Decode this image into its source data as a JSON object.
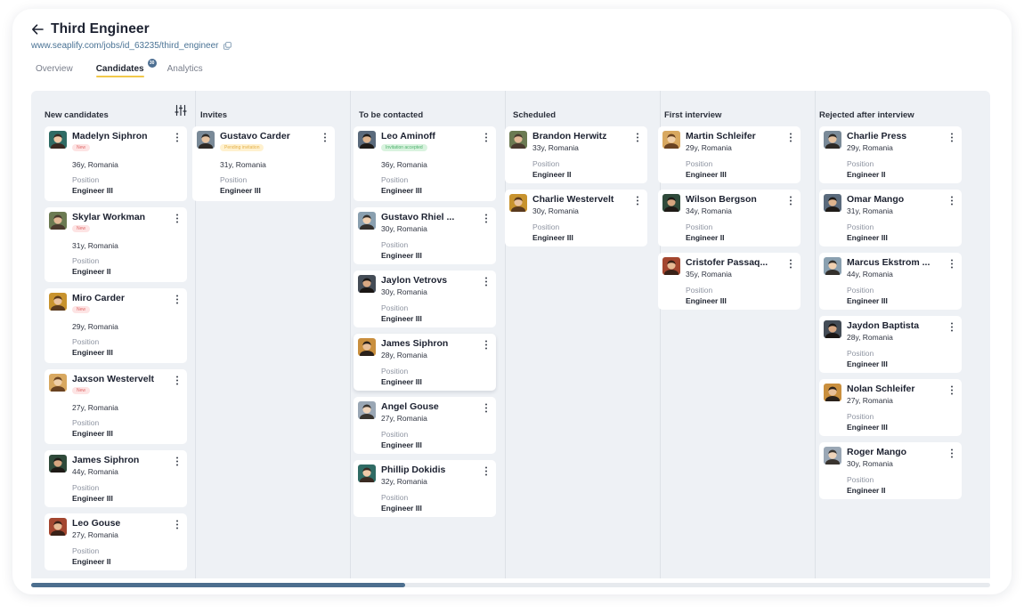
{
  "page": {
    "title": "Third Engineer",
    "url": "www.seaplify.com/jobs/id_63235/third_engineer"
  },
  "tabs": [
    {
      "label": "Overview",
      "active": false
    },
    {
      "label": "Candidates",
      "active": true,
      "badge": "30"
    },
    {
      "label": "Analytics",
      "active": false
    }
  ],
  "colors": {
    "accent_underline": "#f1c84a",
    "badge_bg": "#4d6f92",
    "board_bg": "#eef1f5",
    "scroll_thumb": "#4c6e8e",
    "status_new": "#e06a6a",
    "status_pending": "#e3b04a",
    "status_accepted": "#4bb06a"
  },
  "columns": [
    {
      "title": "New candidates",
      "has_filter": true,
      "cards": [
        {
          "name": "Madelyn Siphron",
          "status": "New",
          "status_type": "new",
          "age_location": "36y, Romania",
          "position_label": "Position",
          "position": "Engineer III"
        },
        {
          "name": "Skylar Workman",
          "status": "New",
          "status_type": "new",
          "age_location": "31y, Romania",
          "position_label": "Position",
          "position": "Engineer II"
        },
        {
          "name": "Miro Carder",
          "status": "New",
          "status_type": "new",
          "age_location": "29y, Romania",
          "position_label": "Position",
          "position": "Engineer III"
        },
        {
          "name": "Jaxson Westervelt",
          "status": "New",
          "status_type": "new",
          "age_location": "27y, Romania",
          "position_label": "Position",
          "position": "Engineer III"
        },
        {
          "name": "James Siphron",
          "status": "",
          "status_type": "",
          "age_location": "44y, Romania",
          "position_label": "Position",
          "position": "Engineer III"
        },
        {
          "name": "Leo Gouse",
          "status": "",
          "status_type": "",
          "age_location": "27y, Romania",
          "position_label": "Position",
          "position": "Engineer II"
        }
      ]
    },
    {
      "title": "Invites",
      "has_filter": false,
      "cards": [
        {
          "name": "Gustavo Carder",
          "status": "Pending invitation",
          "status_type": "pending",
          "age_location": "31y, Romania",
          "position_label": "Position",
          "position": "Engineer III"
        }
      ]
    },
    {
      "title": "To be contacted",
      "has_filter": false,
      "cards": [
        {
          "name": "Leo Aminoff",
          "status": "Invitation accepted",
          "status_type": "accepted",
          "age_location": "36y, Romania",
          "position_label": "Position",
          "position": "Engineer III"
        },
        {
          "name": "Gustavo Rhiel ...",
          "status": "",
          "status_type": "",
          "age_location": "30y, Romania",
          "position_label": "Position",
          "position": "Engineer III"
        },
        {
          "name": "Jaylon Vetrovs",
          "status": "",
          "status_type": "",
          "age_location": "30y, Romania",
          "position_label": "Position",
          "position": "Engineer III"
        },
        {
          "name": "James Siphron",
          "status": "",
          "status_type": "",
          "age_location": "28y, Romania",
          "position_label": "Position",
          "position": "Engineer III",
          "raised": true
        },
        {
          "name": "Angel Gouse",
          "status": "",
          "status_type": "",
          "age_location": "27y, Romania",
          "position_label": "Position",
          "position": "Engineer III"
        },
        {
          "name": "Phillip Dokidis",
          "status": "",
          "status_type": "",
          "age_location": "32y, Romania",
          "position_label": "Position",
          "position": "Engineer III"
        }
      ]
    },
    {
      "title": "Scheduled",
      "has_filter": false,
      "cards": [
        {
          "name": "Brandon Herwitz",
          "status": "",
          "status_type": "",
          "age_location": "33y, Romania",
          "position_label": "Position",
          "position": "Engineer II"
        },
        {
          "name": "Charlie Westervelt",
          "status": "",
          "status_type": "",
          "age_location": "30y, Romania",
          "position_label": "Position",
          "position": "Engineer III"
        }
      ]
    },
    {
      "title": "First interview",
      "has_filter": false,
      "cards": [
        {
          "name": "Martin Schleifer",
          "status": "",
          "status_type": "",
          "age_location": "29y, Romania",
          "position_label": "Position",
          "position": "Engineer III"
        },
        {
          "name": "Wilson Bergson",
          "status": "",
          "status_type": "",
          "age_location": "34y, Romania",
          "position_label": "Position",
          "position": "Engineer II"
        },
        {
          "name": "Cristofer Passaq...",
          "status": "",
          "status_type": "",
          "age_location": "35y, Romania",
          "position_label": "Position",
          "position": "Engineer III"
        }
      ]
    },
    {
      "title": "Rejected after interview",
      "has_filter": false,
      "cards": [
        {
          "name": "Charlie Press",
          "status": "",
          "status_type": "",
          "age_location": "29y, Romania",
          "position_label": "Position",
          "position": "Engineer II"
        },
        {
          "name": "Omar Mango",
          "status": "",
          "status_type": "",
          "age_location": "31y, Romania",
          "position_label": "Position",
          "position": "Engineer III"
        },
        {
          "name": "Marcus Ekstrom ...",
          "status": "",
          "status_type": "",
          "age_location": "44y, Romania",
          "position_label": "Position",
          "position": "Engineer III"
        },
        {
          "name": "Jaydon Baptista",
          "status": "",
          "status_type": "",
          "age_location": "28y, Romania",
          "position_label": "Position",
          "position": "Engineer III"
        },
        {
          "name": "Nolan Schleifer",
          "status": "",
          "status_type": "",
          "age_location": "27y, Romania",
          "position_label": "Position",
          "position": "Engineer III"
        },
        {
          "name": "Roger Mango",
          "status": "",
          "status_type": "",
          "age_location": "30y, Romania",
          "position_label": "Position",
          "position": "Engineer II"
        }
      ]
    }
  ],
  "scrollbar": {
    "position_fraction": 0.39
  }
}
